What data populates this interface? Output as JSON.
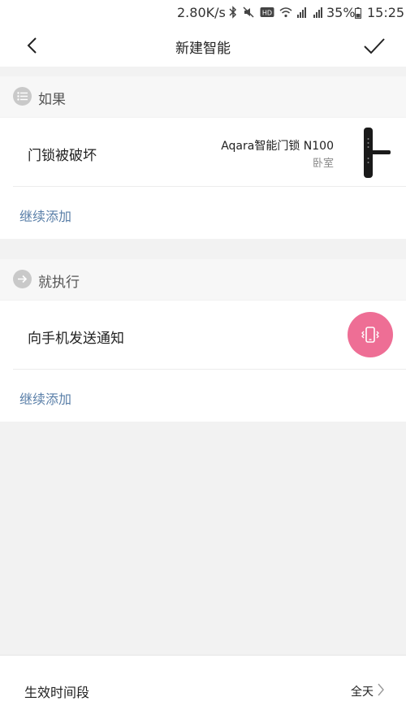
{
  "status_bar": {
    "net_speed": "2.80K/s",
    "battery": "35%",
    "time": "15:25",
    "icons": [
      "bluetooth-icon",
      "mute-icon",
      "hd-icon",
      "wifi-icon",
      "signal-icon",
      "signal-4g-icon",
      "battery-icon"
    ]
  },
  "header": {
    "title": "新建智能",
    "back_icon": "chevron-left-icon",
    "confirm_icon": "checkmark-icon"
  },
  "if_section": {
    "label": "如果",
    "icon": "list-icon",
    "trigger": {
      "label": "门锁被破坏",
      "device_name": "Aqara智能门锁 N100",
      "device_room": "卧室"
    },
    "add_more": "继续添加"
  },
  "then_section": {
    "label": "就执行",
    "icon": "arrow-right-icon",
    "action": {
      "label": "向手机发送通知",
      "icon": "phone-vibrate-icon",
      "icon_color": "#ee6e95"
    },
    "add_more": "继续添加"
  },
  "bottom": {
    "label": "生效时间段",
    "value": "全天"
  },
  "colors": {
    "link": "#5a7fa8",
    "background": "#f2f2f2",
    "accent_pink": "#ee6e95"
  }
}
